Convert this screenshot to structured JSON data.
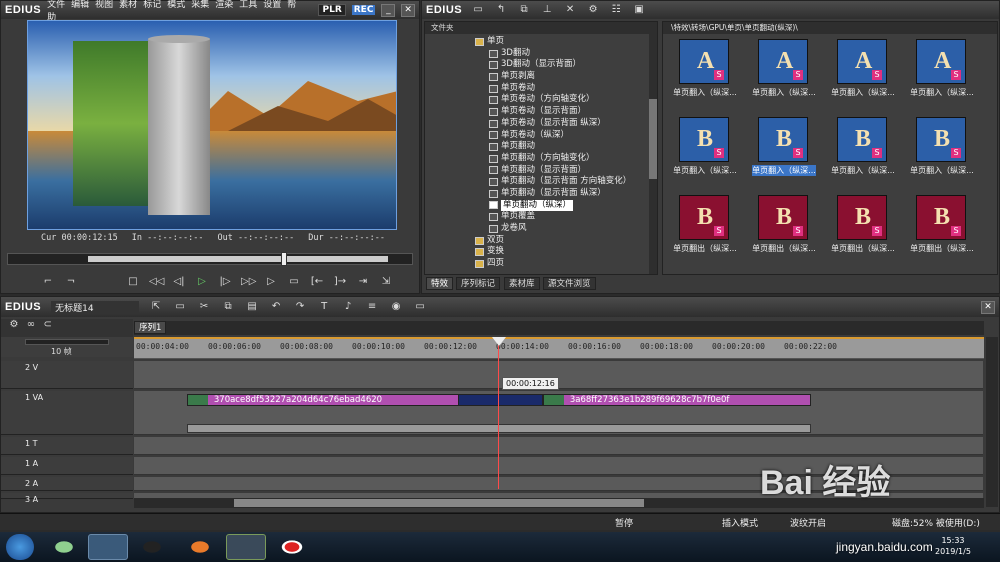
{
  "app": {
    "logo": "EDIUS",
    "menu": [
      "文件",
      "编辑",
      "视图",
      "素材",
      "标记",
      "模式",
      "采集",
      "渲染",
      "工具",
      "设置",
      "帮助"
    ],
    "plr": "PLR",
    "rec": "REC"
  },
  "player": {
    "cur_label": "Cur",
    "cur_value": "00:00:12:15",
    "in_label": "In",
    "in_value": "--:--:--:--",
    "out_label": "Out",
    "out_value": "--:--:--:--",
    "dur_label": "Dur",
    "dur_value": "--:--:--:--",
    "scrub_position": 0.68
  },
  "library": {
    "logo": "EDIUS",
    "tree_header": "文件夹",
    "path": "\\特效\\转场\\GPU\\单页\\单页翻动(纵深)\\",
    "tree_items": [
      {
        "label": "单页",
        "level": 0,
        "folder": true
      },
      {
        "label": "3D翻动",
        "level": 1
      },
      {
        "label": "3D翻动（显示背面）",
        "level": 1
      },
      {
        "label": "单页剥离",
        "level": 1
      },
      {
        "label": "单页卷动",
        "level": 1
      },
      {
        "label": "单页卷动（方向轴变化）",
        "level": 1
      },
      {
        "label": "单页卷动（显示背面）",
        "level": 1
      },
      {
        "label": "单页卷动（显示背面 纵深）",
        "level": 1
      },
      {
        "label": "单页卷动（纵深）",
        "level": 1
      },
      {
        "label": "单页翻动",
        "level": 1
      },
      {
        "label": "单页翻动（方向轴变化）",
        "level": 1
      },
      {
        "label": "单页翻动（显示背面）",
        "level": 1
      },
      {
        "label": "单页翻动（显示背面 方向轴变化）",
        "level": 1
      },
      {
        "label": "单页翻动（显示背面 纵深）",
        "level": 1
      },
      {
        "label": "单页翻动（纵深）",
        "level": 1,
        "selected": true
      },
      {
        "label": "单页覆盖",
        "level": 1
      },
      {
        "label": "龙卷风",
        "level": 1
      },
      {
        "label": "双页",
        "level": 0,
        "folder": true
      },
      {
        "label": "变换",
        "level": 0,
        "folder": true
      },
      {
        "label": "四页",
        "level": 0,
        "folder": true
      }
    ],
    "thumbs": [
      {
        "label": "单页翻入（纵深...",
        "letter": "A",
        "bg": "#2c5fa8"
      },
      {
        "label": "单页翻入（纵深...",
        "letter": "A",
        "bg": "#2c5fa8"
      },
      {
        "label": "单页翻入（纵深...",
        "letter": "A",
        "bg": "#2c5fa8"
      },
      {
        "label": "单页翻入（纵深...",
        "letter": "A",
        "bg": "#2c5fa8"
      },
      {
        "label": "单页翻入（纵深...",
        "letter": "B",
        "bg": "#2c5fa8"
      },
      {
        "label": "单页翻入（纵深...",
        "letter": "B",
        "bg": "#2c5fa8",
        "selected": true
      },
      {
        "label": "单页翻入（纵深...",
        "letter": "B",
        "bg": "#2c5fa8"
      },
      {
        "label": "单页翻入（纵深...",
        "letter": "B",
        "bg": "#2c5fa8"
      },
      {
        "label": "单页翻出（纵深...",
        "letter": "B",
        "bg": "#8a1030"
      },
      {
        "label": "单页翻出（纵深...",
        "letter": "B",
        "bg": "#8a1030"
      },
      {
        "label": "单页翻出（纵深...",
        "letter": "B",
        "bg": "#8a1030"
      },
      {
        "label": "单页翻出（纵深...",
        "letter": "B",
        "bg": "#8a1030"
      }
    ],
    "tabs": [
      "特效",
      "序列标记",
      "素材库",
      "源文件浏览"
    ],
    "active_tab": 0
  },
  "timeline": {
    "logo": "EDIUS",
    "project_name": "无标题14",
    "sequence_tab": "序列1",
    "zoom_label": "10 帧",
    "ruler": [
      "00:00:04:00",
      "00:00:06:00",
      "00:00:08:00",
      "00:00:10:00",
      "00:00:12:00",
      "00:00:14:00",
      "00:00:16:00",
      "00:00:18:00",
      "00:00:20:00",
      "00:00:22:00"
    ],
    "tooltip": "00:00:12:16",
    "tracks": [
      {
        "name": "2 V",
        "type": "V"
      },
      {
        "name": "1 VA",
        "type": "VA"
      },
      {
        "name": "1 T",
        "type": "T"
      },
      {
        "name": "1 A",
        "type": "A"
      },
      {
        "name": "2 A",
        "type": "A"
      },
      {
        "name": "3 A",
        "type": "A"
      }
    ],
    "clip1_name": "370ace8df53227a204d64c76ebad4620",
    "clip2_name": "3a68ff27363e1b289f69628c7b7f0e0f"
  },
  "status": {
    "pause": "暂停",
    "insert_mode": "插入模式",
    "ripple": "波纹开启",
    "disk": "磁盘:52% 被使用(D:)"
  },
  "taskbar": {
    "time": "15:33",
    "date": "2019/1/5"
  },
  "watermark": {
    "brand": "Bai 经验",
    "url": "jingyan.baidu.com"
  },
  "colors": {
    "clip": "#b04fb0",
    "rec": "#3b76c8",
    "timeline_bg": "#5a5a5a"
  }
}
